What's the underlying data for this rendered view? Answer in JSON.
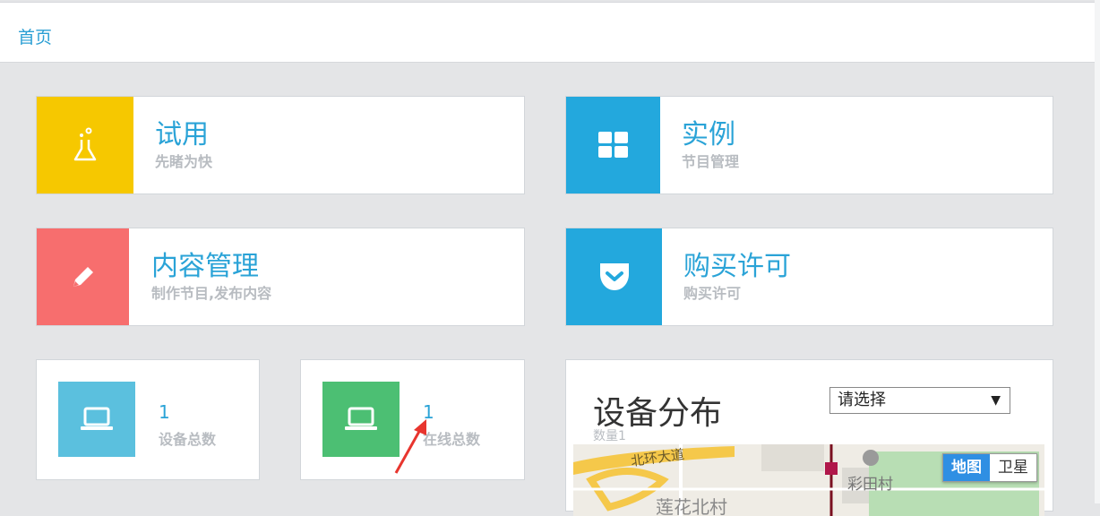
{
  "header": {
    "home_link": "首页"
  },
  "tiles": [
    {
      "title": "试用",
      "subtitle": "先睹为快",
      "icon": "flask-icon",
      "color": "#f6c800"
    },
    {
      "title": "实例",
      "subtitle": "节目管理",
      "icon": "grid-icon",
      "color": "#23a8dd"
    },
    {
      "title": "内容管理",
      "subtitle": "制作节目,发布内容",
      "icon": "pencil-icon",
      "color": "#f76e6e"
    },
    {
      "title": "购买许可",
      "subtitle": "购买许可",
      "icon": "pocket-icon",
      "color": "#23a8dd"
    }
  ],
  "stats": [
    {
      "value": "1",
      "label": "设备总数",
      "icon": "laptop-icon",
      "color": "#5bc0de"
    },
    {
      "value": "1",
      "label": "在线总数",
      "icon": "laptop-icon",
      "color": "#4cbf73"
    }
  ],
  "device_map": {
    "title": "设备分布",
    "count_label": "数量1",
    "select_value": "请选择",
    "map_type_map": "地图",
    "map_type_satellite": "卫星",
    "map_labels": {
      "road": "北环大道",
      "village": "彩田村",
      "district": "莲花北村"
    }
  }
}
